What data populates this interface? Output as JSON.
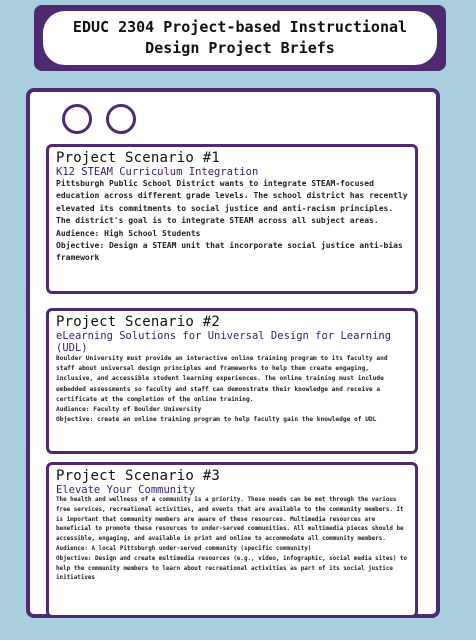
{
  "header": {
    "title": "EDUC 2304 Project-based Instructional Design Project Briefs"
  },
  "scenarios": [
    {
      "heading": "Project Scenario #1",
      "subtitle": "K12 STEAM Curriculum Integration",
      "description": "Pittsburgh Public School District wants to integrate STEAM-focused education across different grade levels. The school district has recently elevated its commitments to social justice and anti-racism principles. The district's goal is to integrate STEAM across all subject areas.",
      "audience": "Audience: High School Students",
      "objective": "Objective: Design a STEAM unit that incorporate social justice anti-bias framework"
    },
    {
      "heading": "Project Scenario #2",
      "subtitle": "eLearning Solutions for Universal Design for Learning (UDL)",
      "description": "Boulder University must provide an interactive online training program to its faculty and staff about universal design principles and frameworks to help them create engaging, inclusive, and accessible student learning experiences. The online training must include embedded assessments so faculty and staff can demonstrate their knowledge and receive a certificate at the completion of the online training.",
      "audience": "Audience: Faculty of Boulder University",
      "objective": "Objective: create an online training program to help faculty gain the knowledge of UDL"
    },
    {
      "heading": "Project Scenario #3",
      "subtitle": "Elevate Your Community",
      "description": "The health and wellness of a community is a priority. These needs can be met through the various free services, recreational activities, and events that are available to the community members. It is important that community members are aware of these resources. Multimedia resources are beneficial to promote these resources to under-served communities. All multimedia pieces should be accessible, engaging, and available in print and online to accommodate all community members.",
      "audience": "Audience: A local Pittsburgh under-served community (specific community)",
      "objective": "Objective: Design and create multimedia resources (e.g., video, infographic, social media sites) to help the community members to learn about recreational activities as part of its social justice initiatives"
    }
  ],
  "colors": {
    "background": "#a9cfdf",
    "accent": "#4e2a72"
  }
}
